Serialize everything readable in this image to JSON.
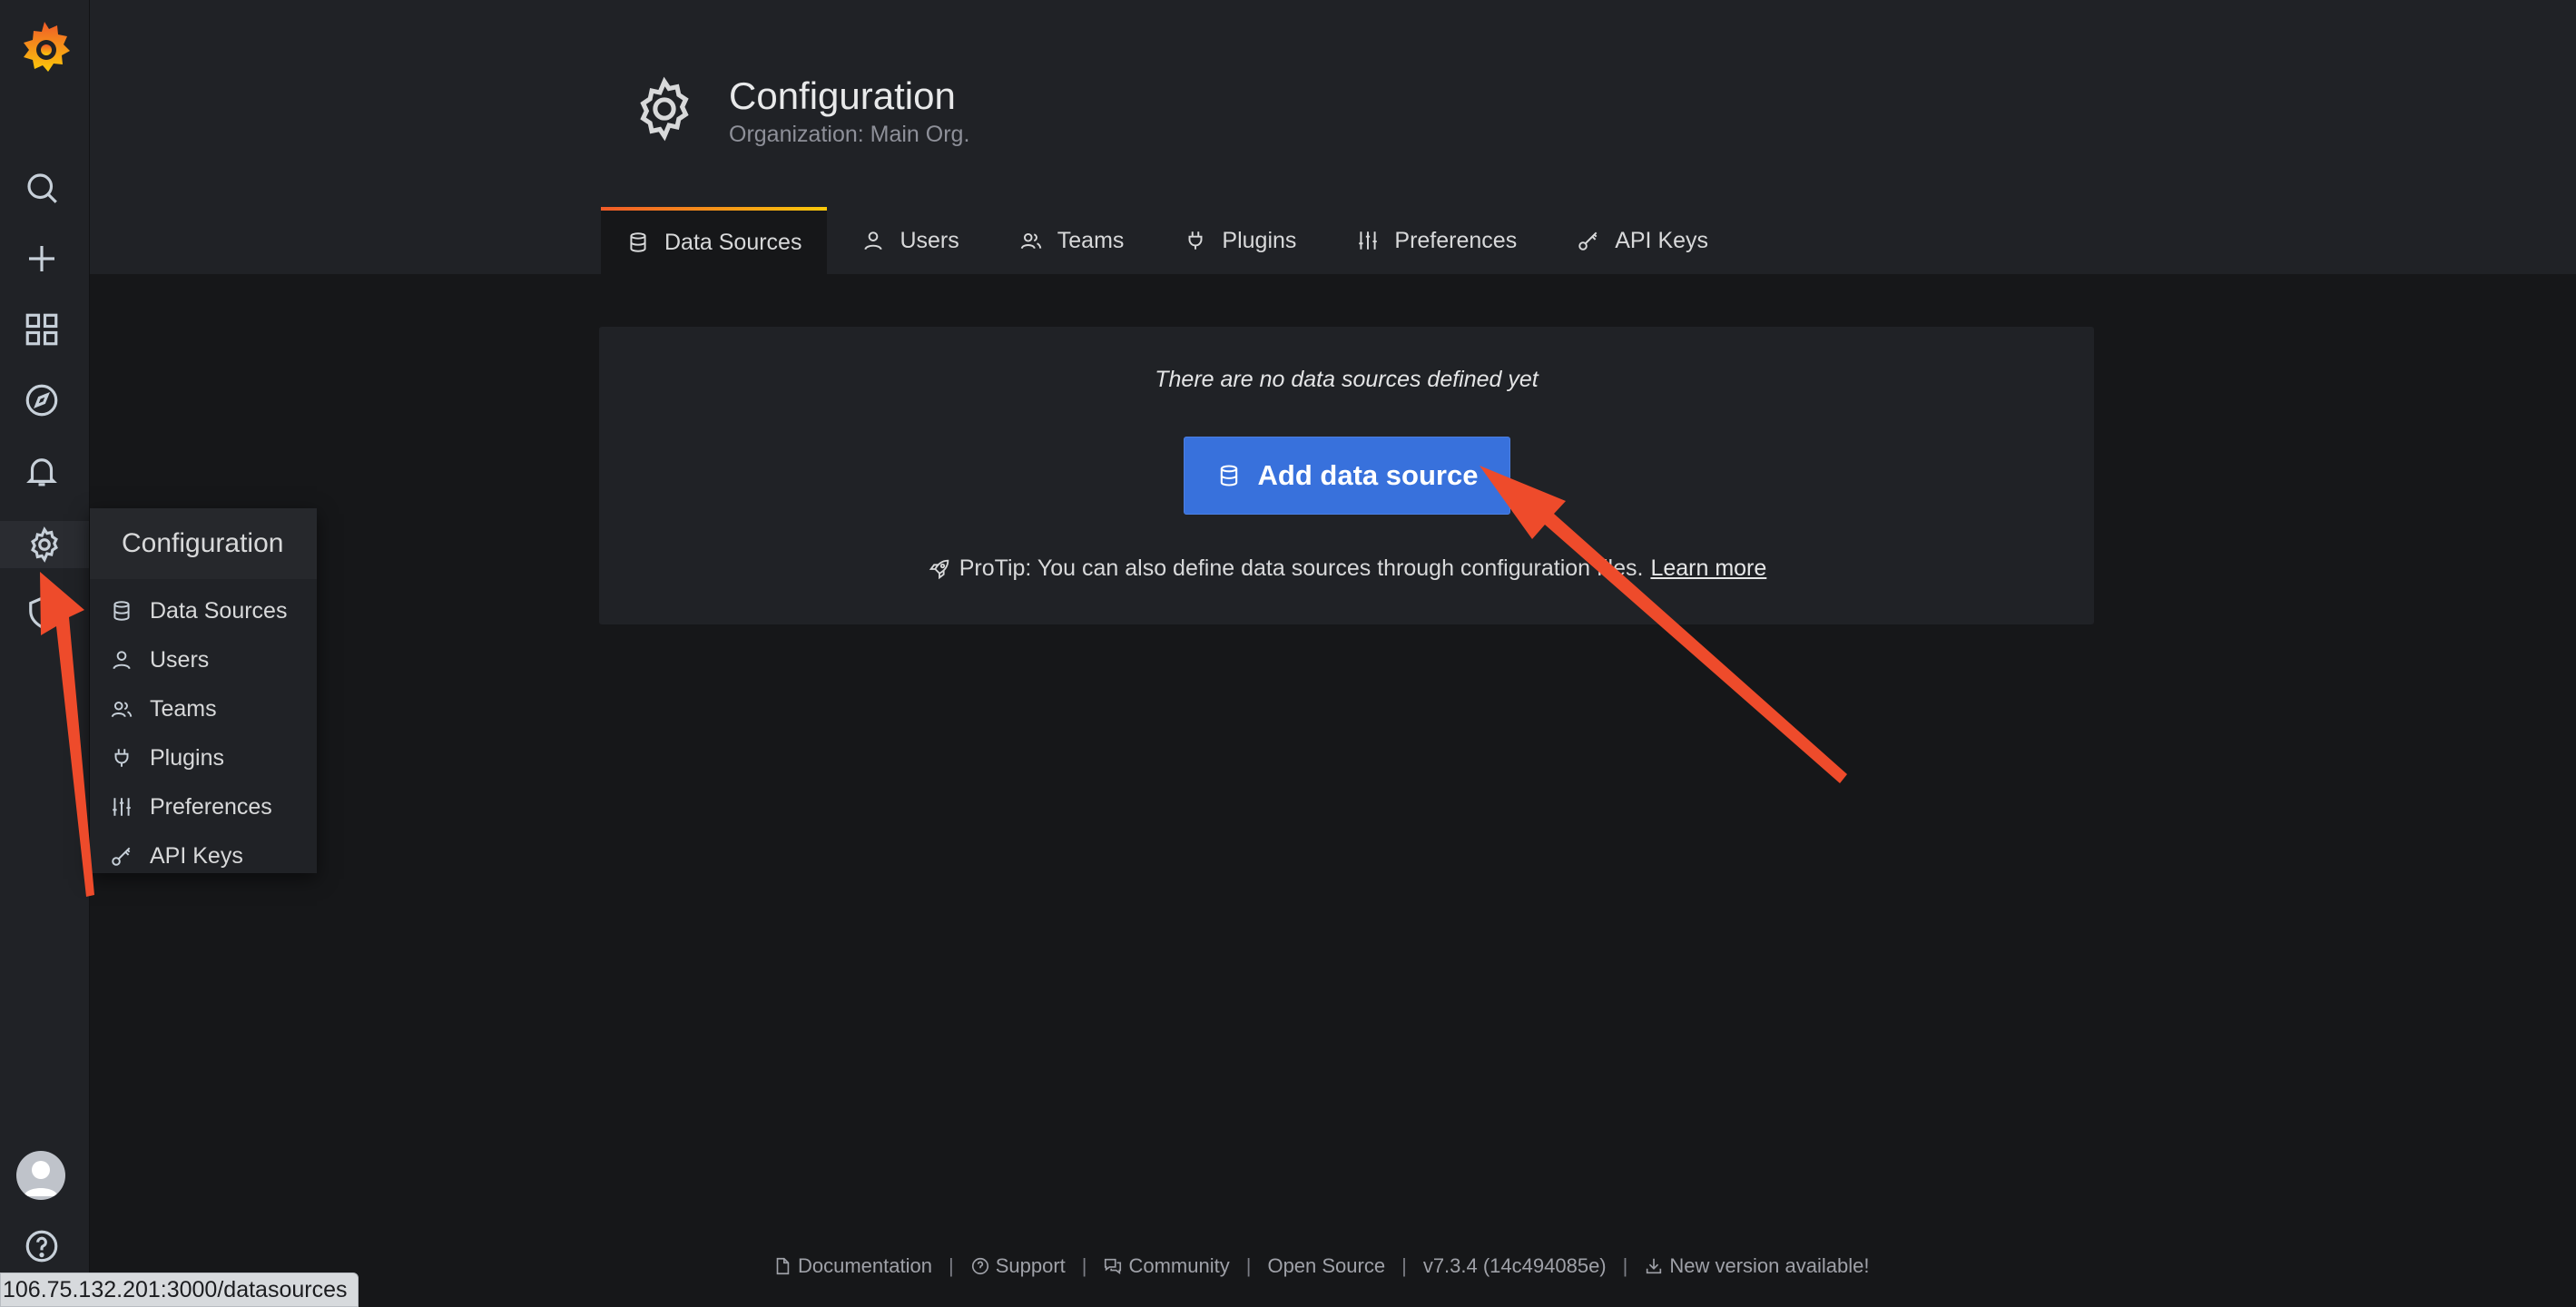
{
  "sidebar": {
    "logo": "grafana-logo",
    "icons": [
      "search-icon",
      "plus-icon",
      "dashboards-icon",
      "explore-compass-icon",
      "alerting-bell-icon",
      "gear-icon",
      "shield-icon"
    ],
    "active": "gear-icon"
  },
  "flyout": {
    "title": "Configuration",
    "items": [
      {
        "label": "Data Sources",
        "icon": "database-icon"
      },
      {
        "label": "Users",
        "icon": "user-icon"
      },
      {
        "label": "Teams",
        "icon": "users-icon"
      },
      {
        "label": "Plugins",
        "icon": "plug-icon"
      },
      {
        "label": "Preferences",
        "icon": "sliders-icon"
      },
      {
        "label": "API Keys",
        "icon": "key-icon"
      }
    ]
  },
  "header": {
    "title": "Configuration",
    "subtitle": "Organization: Main Org."
  },
  "tabs": [
    {
      "label": "Data Sources",
      "active": true
    },
    {
      "label": "Users"
    },
    {
      "label": "Teams"
    },
    {
      "label": "Plugins"
    },
    {
      "label": "Preferences"
    },
    {
      "label": "API Keys"
    }
  ],
  "main": {
    "empty_text": "There are no data sources defined yet",
    "add_button": "Add data source",
    "protip": "ProTip: You can also define data sources through configuration files.",
    "learn_more": "Learn more"
  },
  "footer": {
    "documentation": "Documentation",
    "support": "Support",
    "community": "Community",
    "open_source": "Open Source",
    "version": "v7.3.4 (14c494085e)",
    "new_version": "New version available!"
  },
  "status_url": "106.75.132.201:3000/datasources",
  "colors": {
    "accent_blue": "#3871dc",
    "annotation_arrow": "#ee4b2b",
    "tab_gradient_start": "#f05a28",
    "tab_gradient_end": "#fbca0a"
  }
}
